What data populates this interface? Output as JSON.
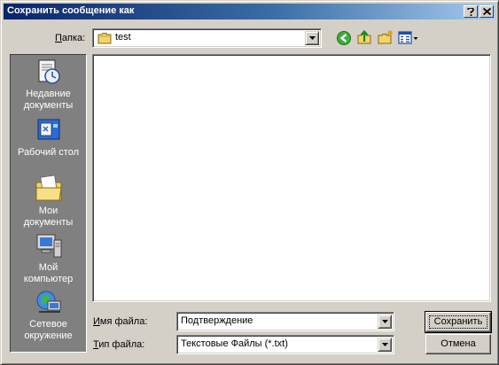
{
  "window": {
    "title": "Сохранить сообщение как",
    "help_glyph": "?",
    "close_glyph": "✕"
  },
  "folder": {
    "label_hotkey": "П",
    "label_rest": "апка:",
    "value": "test"
  },
  "toolbar": {
    "icons": [
      "back-icon",
      "up-folder-icon",
      "new-folder-icon",
      "view-menu-icon"
    ]
  },
  "places": [
    {
      "line1": "Недавние",
      "line2": "документы",
      "icon": "recent-documents-icon"
    },
    {
      "line1": "Рабочий стол",
      "line2": "",
      "icon": "desktop-icon"
    },
    {
      "line1": "Мои",
      "line2": "документы",
      "icon": "my-documents-icon"
    },
    {
      "line1": "Мой",
      "line2": "компьютер",
      "icon": "my-computer-icon"
    },
    {
      "line1": "Сетевое",
      "line2": "окружение",
      "icon": "network-icon"
    }
  ],
  "filename": {
    "label_hotkey": "И",
    "label_rest": "мя файла:",
    "value": "Подтверждение"
  },
  "filetype": {
    "label_hotkey": "Т",
    "label_rest": "ип файла:",
    "value": "Текстовые Файлы (*.txt)"
  },
  "buttons": {
    "save": "Сохранить",
    "cancel": "Отмена"
  },
  "colors": {
    "title_start": "#0a246a",
    "title_end": "#a6caf0",
    "face": "#d4d0c8",
    "places_bg": "#808080"
  }
}
